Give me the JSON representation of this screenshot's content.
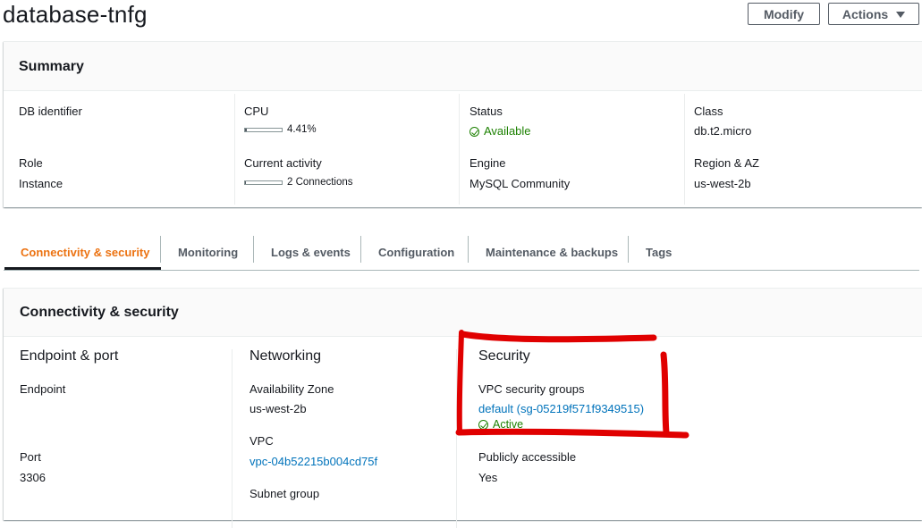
{
  "header": {
    "title": "database-tnfg",
    "modify_label": "Modify",
    "actions_label": "Actions"
  },
  "summary": {
    "title": "Summary",
    "db_identifier_label": "DB identifier",
    "cpu_label": "CPU",
    "cpu_value": "4.41%",
    "cpu_fraction": 0.0441,
    "status_label": "Status",
    "status_value": "Available",
    "class_label": "Class",
    "class_value": "db.t2.micro",
    "role_label": "Role",
    "role_value": "Instance",
    "activity_label": "Current activity",
    "activity_value": "2 Connections",
    "activity_fraction": 0.02,
    "engine_label": "Engine",
    "engine_value": "MySQL Community",
    "region_label": "Region & AZ",
    "region_value": "us-west-2b"
  },
  "tabs": [
    {
      "label": "Connectivity & security",
      "active": true
    },
    {
      "label": "Monitoring"
    },
    {
      "label": "Logs & events"
    },
    {
      "label": "Configuration"
    },
    {
      "label": "Maintenance & backups"
    },
    {
      "label": "Tags"
    }
  ],
  "connectivity": {
    "title": "Connectivity & security",
    "endpoint_port": {
      "title": "Endpoint & port",
      "endpoint_label": "Endpoint",
      "port_label": "Port",
      "port_value": "3306"
    },
    "networking": {
      "title": "Networking",
      "az_label": "Availability Zone",
      "az_value": "us-west-2b",
      "vpc_label": "VPC",
      "vpc_value": "vpc-04b52215b004cd75f",
      "subnet_label": "Subnet group"
    },
    "security": {
      "title": "Security",
      "sg_label": "VPC security groups",
      "sg_value": "default (sg-05219f571f9349515)",
      "sg_status": "Active",
      "public_label": "Publicly accessible",
      "public_value": "Yes"
    }
  },
  "colors": {
    "accent": "#ec7211",
    "link": "#0073bb",
    "success": "#1d8102",
    "annotation": "#e00000"
  }
}
